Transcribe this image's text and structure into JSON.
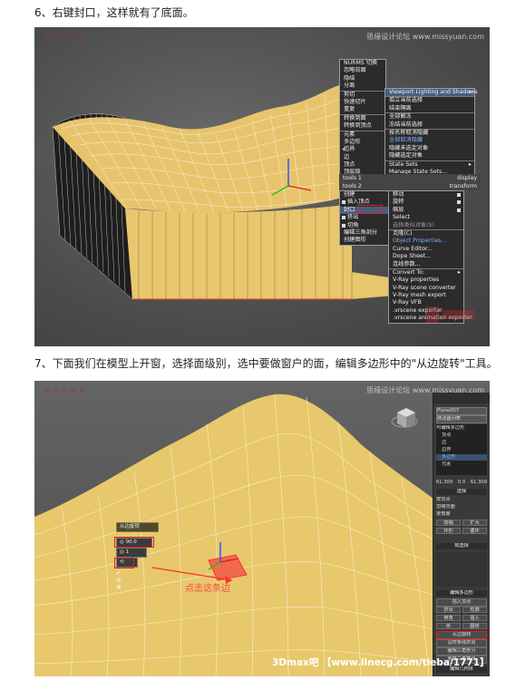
{
  "steps": {
    "step6": "6、右键封口，这样就有了底面。",
    "step7": "7、下面我们在模型上开窗，选择面级别，选中要做窗户的面，编辑多边形中的\"从边旋转\"工具。"
  },
  "panel1": {
    "watermark_right": "思缘设计论坛 www.missyuan.com",
    "quad_left": [
      {
        "label": "NURMS 切换"
      },
      {
        "label": "忽略背面"
      },
      {
        "label": "隐结"
      },
      {
        "label": "分离"
      },
      {
        "label": "剪切"
      },
      {
        "label": "快速切片"
      },
      {
        "label": "重复"
      },
      {
        "label": "转换到面"
      },
      {
        "label": "转换到顶点"
      },
      {
        "label": "元素"
      },
      {
        "label": "多边形"
      },
      {
        "label": "边界"
      },
      {
        "label": "边"
      },
      {
        "label": "顶点"
      },
      {
        "label": "顶层级"
      }
    ],
    "quad_right": [
      {
        "label": "Viewport Lighting and Shadows"
      },
      {
        "label": "孤立当前选择"
      },
      {
        "label": "结束隔离"
      },
      {
        "label": "全部解冻"
      },
      {
        "label": "冻结当前选择"
      },
      {
        "label": "按名称取消隐藏"
      },
      {
        "label": "全部取消隐藏"
      },
      {
        "label": "隐藏未选定对象"
      },
      {
        "label": "隐藏选定对象"
      },
      {
        "label": "State Sets"
      },
      {
        "label": "Manage State Sets..."
      }
    ],
    "quad_header_left": "tools 1",
    "quad_header_right_a": "display",
    "quad_header_right_b": "transform",
    "quad_header_left_b": "tools 2",
    "lower_left": [
      {
        "label": "创建"
      },
      {
        "label": "插入顶点"
      },
      {
        "label": "封口"
      },
      {
        "label": "挤出"
      },
      {
        "label": "切角"
      },
      {
        "label": "编辑三角剖分"
      },
      {
        "label": "创建图形"
      }
    ],
    "lower_right": [
      {
        "label": "移动"
      },
      {
        "label": "旋转"
      },
      {
        "label": "缩放"
      },
      {
        "label": "Select"
      },
      {
        "label": "选择类似对象(S)"
      },
      {
        "label": "克隆(C)"
      },
      {
        "label": "Object Properties..."
      },
      {
        "label": "Curve Editor..."
      },
      {
        "label": "Dope Sheet..."
      },
      {
        "label": "连线参数..."
      },
      {
        "label": "Convert To:"
      },
      {
        "label": "V-Ray properties"
      },
      {
        "label": "V-Ray scene converter"
      },
      {
        "label": "V-Ray mesh export"
      },
      {
        "label": "V-Ray VFB"
      },
      {
        "label": ".vrscene exporter"
      },
      {
        "label": ".vrscene animation exporter"
      }
    ]
  },
  "panel2": {
    "watermark_right": "思缘设计论坛 www.missyuan.com",
    "caddy_title": "从边旋转",
    "caddy_value_a": "90.0",
    "caddy_value_b": "1",
    "annotation": "点击这条边",
    "right_panel": {
      "object_name": "Plane007",
      "modifier_list": "修改器列表",
      "stack": [
        "可编辑多边形",
        "顶点",
        "边",
        "边界",
        "多边形",
        "元素"
      ],
      "numbers": [
        "61.309",
        "0.0",
        "61.309"
      ],
      "sections": [
        "选择",
        "软选择",
        "编辑多边形",
        "编辑几何体"
      ],
      "items": [
        "按顶点",
        "忽略背面",
        "按角度",
        "收缩",
        "扩大",
        "环形",
        "循环",
        "插入顶点",
        "挤出",
        "轮廓",
        "倒角",
        "插入",
        "桥",
        "翻转",
        "从边旋转",
        "沿样条线挤出",
        "编辑三角剖分",
        "重复三角算法"
      ]
    },
    "bottom_watermark": "3Dmax吧 【www.linecg.com/tieba/1771】"
  }
}
